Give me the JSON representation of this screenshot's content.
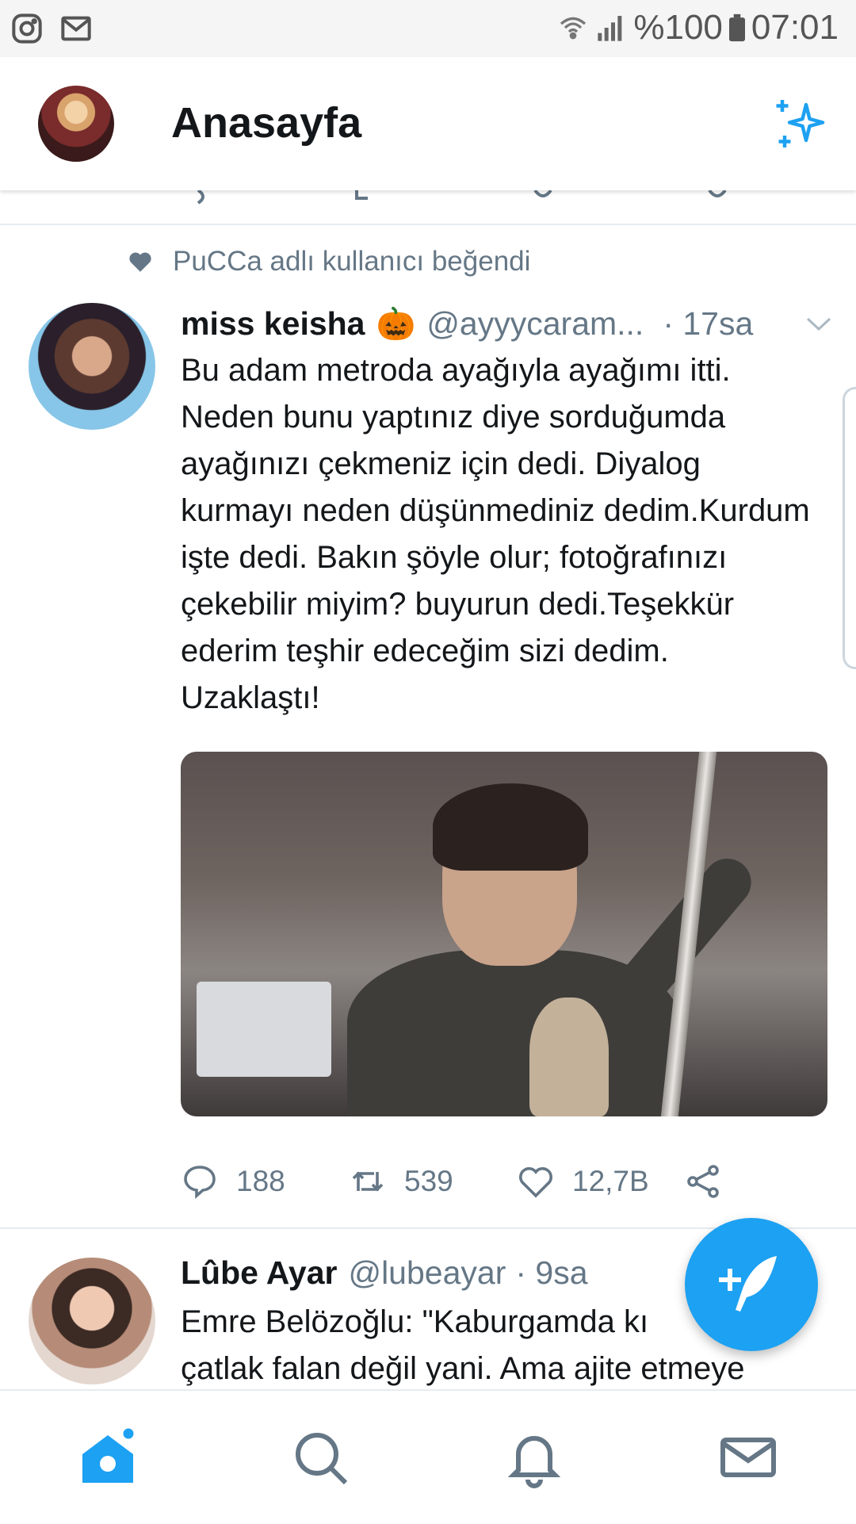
{
  "status_bar": {
    "battery": "%100",
    "time": "07:01",
    "icons": [
      "instagram-icon",
      "mail-icon",
      "wifi-icon",
      "signal-icon",
      "battery-icon"
    ]
  },
  "header": {
    "title": "Anasayfa",
    "icons": [
      "profile-avatar",
      "sparkle-icon"
    ]
  },
  "feed": {
    "liked_by": "PuCCa adlı kullanıcı beğendi",
    "tweet1": {
      "name": "miss keisha",
      "emoji": "🎃",
      "handle": "@ayyycaram...",
      "time": "· 17sa",
      "text": "Bu adam metroda ayağıyla ayağımı itti. Neden bunu yaptınız diye sorduğumda ayağınızı çekmeniz için dedi. Diyalog kurmayı neden düşünmediniz dedim.Kurdum işte dedi. Bakın şöyle olur; fotoğrafınızı çekebilir miyim? buyurun dedi.Teşekkür ederim teşhir edeceğim sizi dedim. Uzaklaştı!",
      "replies": "188",
      "retweets": "539",
      "likes": "12,7B"
    },
    "tweet2": {
      "name": "Lûbe Ayar",
      "handle": "@lubeayar",
      "time": "· 9sa",
      "text_line1": "Emre Belözoğlu: \"Kaburgamda kı",
      "text_line2": "çatlak falan değil yani. Ama ajite etmeye"
    }
  },
  "colors": {
    "accent": "#1da1f2",
    "muted": "#657786",
    "text": "#14171a",
    "divider": "#e6ecf0"
  },
  "bottom_nav": [
    "home-icon",
    "search-icon",
    "notifications-icon",
    "messages-icon"
  ]
}
